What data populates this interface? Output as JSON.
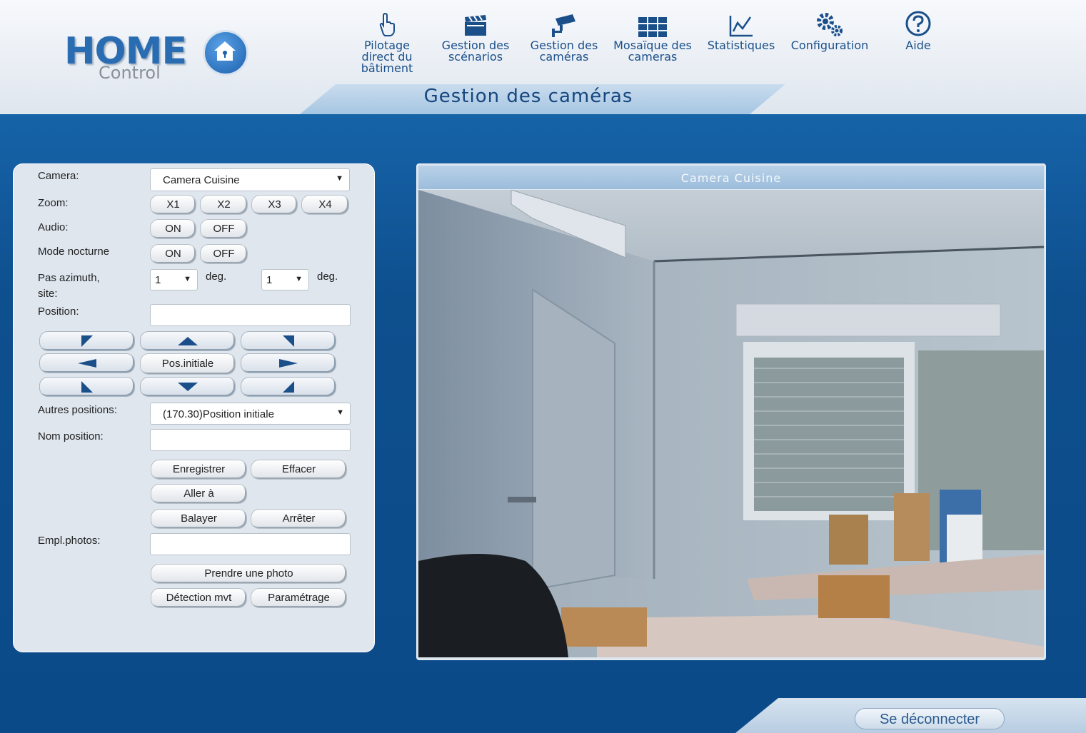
{
  "brand": {
    "home": "HOME",
    "control": "Control"
  },
  "nav": [
    {
      "icon": "hand-pointer-icon",
      "label": "Pilotage direct du bâtiment"
    },
    {
      "icon": "clapperboard-icon",
      "label": "Gestion des scénarios"
    },
    {
      "icon": "security-camera-icon",
      "label": "Gestion des caméras"
    },
    {
      "icon": "grid-icon",
      "label": "Mosaïque des cameras"
    },
    {
      "icon": "chart-line-icon",
      "label": "Statistiques"
    },
    {
      "icon": "gears-icon",
      "label": "Configuration"
    },
    {
      "icon": "help-circle-icon",
      "label": "Aide"
    }
  ],
  "page_title": "Gestion des caméras",
  "controls": {
    "camera_label": "Camera:",
    "camera_value": "Camera Cuisine",
    "zoom_label": "Zoom:",
    "zoom_buttons": [
      "X1",
      "X2",
      "X3",
      "X4"
    ],
    "audio_label": "Audio:",
    "night_label": "Mode nocturne",
    "on": "ON",
    "off": "OFF",
    "step_label": "Pas azimuth, site:",
    "azimuth_value": "1",
    "site_value": "1",
    "deg": "deg.",
    "position_label": "Position:",
    "position_value": "",
    "home_button": "Pos.initiale",
    "other_positions_label": "Autres positions:",
    "other_positions_value": "(170.30)Position initiale",
    "name_label": "Nom position:",
    "name_value": "",
    "save": "Enregistrer",
    "erase": "Effacer",
    "goto": "Aller à",
    "sweep": "Balayer",
    "stop": "Arrêter",
    "photos_label": "Empl.photos:",
    "photos_value": "",
    "take_photo": "Prendre une photo",
    "motion": "Détection mvt",
    "settings": "Paramétrage"
  },
  "camera_view": {
    "title": "Camera Cuisine"
  },
  "logout": "Se déconnecter"
}
